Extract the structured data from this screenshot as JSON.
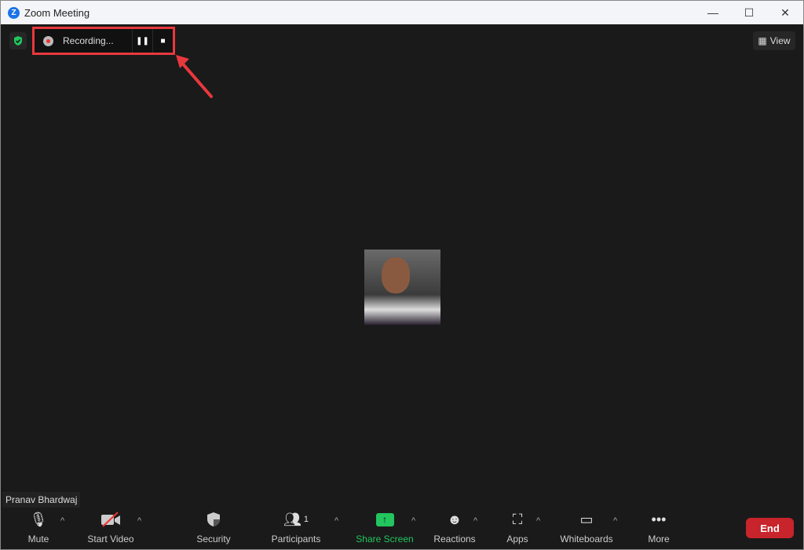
{
  "window": {
    "title": "Zoom Meeting",
    "minimize": "—",
    "maximize": "☐",
    "close": "✕"
  },
  "recording": {
    "label": "Recording...",
    "pause": "❚❚",
    "stop": "■"
  },
  "view_label": "View",
  "participant_name": "Pranav Bhardwaj",
  "toolbar": {
    "mute": "Mute",
    "start_video": "Start Video",
    "security": "Security",
    "participants": "Participants",
    "participants_count": "1",
    "share_screen": "Share Screen",
    "reactions": "Reactions",
    "apps": "Apps",
    "whiteboards": "Whiteboards",
    "more": "More",
    "end": "End",
    "caret": "^"
  },
  "colors": {
    "share": "#22c55e",
    "end": "#c8242b",
    "highlight": "#e8383d"
  }
}
